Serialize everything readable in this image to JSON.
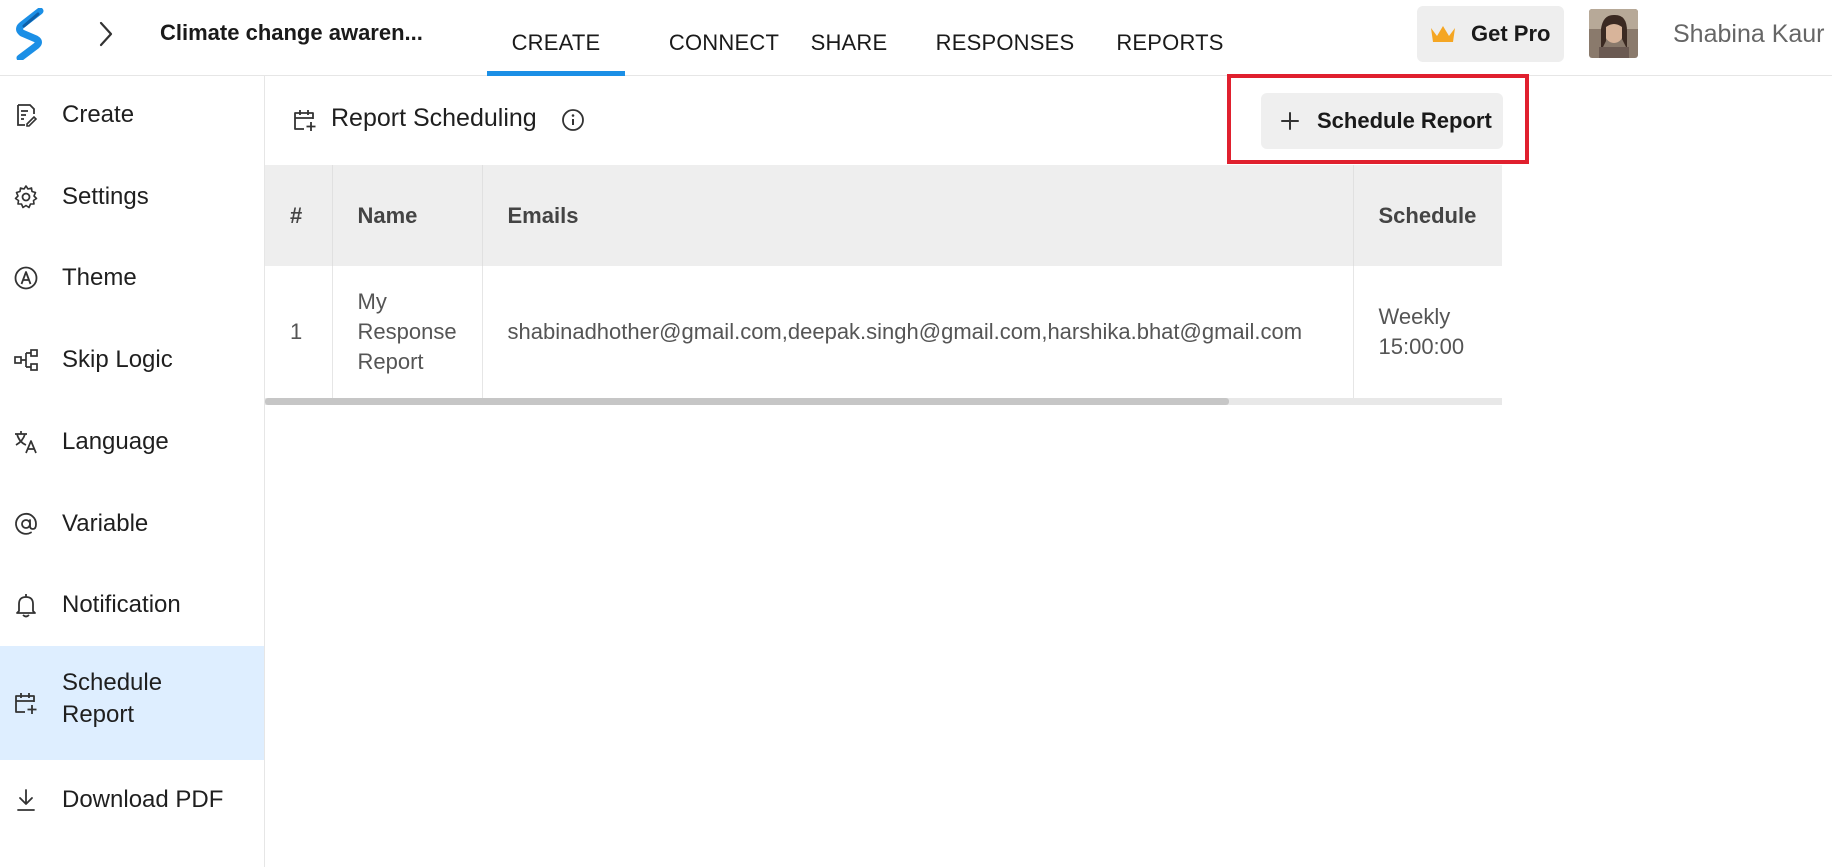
{
  "header": {
    "form_title": "Climate change awaren...",
    "tabs": [
      {
        "label": "CREATE",
        "active": true
      },
      {
        "label": "CONNECT",
        "active": false
      },
      {
        "label": "SHARE",
        "active": false
      },
      {
        "label": "RESPONSES",
        "active": false
      },
      {
        "label": "REPORTS",
        "active": false
      }
    ],
    "get_pro_label": "Get Pro",
    "user_name": "Shabina Kaur"
  },
  "sidebar": {
    "items": [
      {
        "label": "Create",
        "icon": "form-edit-icon"
      },
      {
        "label": "Settings",
        "icon": "gear-icon"
      },
      {
        "label": "Theme",
        "icon": "theme-icon"
      },
      {
        "label": "Skip Logic",
        "icon": "skip-logic-icon"
      },
      {
        "label": "Language",
        "icon": "translate-icon"
      },
      {
        "label": "Variable",
        "icon": "at-sign-icon"
      },
      {
        "label": "Notification",
        "icon": "bell-icon"
      },
      {
        "label": "Schedule Report",
        "icon": "calendar-add-icon",
        "active": true
      },
      {
        "label": "Download PDF",
        "icon": "download-icon"
      }
    ]
  },
  "main": {
    "title": "Report Scheduling",
    "schedule_button_label": "Schedule Report",
    "table": {
      "columns": [
        "#",
        "Name",
        "Emails",
        "Schedule"
      ],
      "rows": [
        {
          "index": "1",
          "name": "My Response Report",
          "emails": "shabinadhother@gmail.com,deepak.singh@gmail.com,harshika.bhat@gmail.com",
          "schedule": "Weekly 15:00:00"
        }
      ]
    }
  },
  "colors": {
    "accent": "#1b8fe6",
    "active_sidebar_bg": "#deeeff",
    "highlight": "#e0202e",
    "crown": "#f5a623"
  }
}
